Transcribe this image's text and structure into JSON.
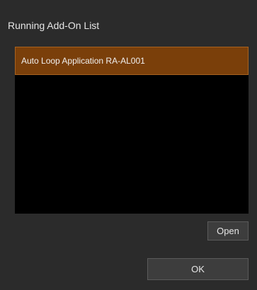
{
  "dialog": {
    "title": "Running Add-On List"
  },
  "list": {
    "items": [
      {
        "label": "Auto Loop Application RA-AL001",
        "selected": true
      }
    ]
  },
  "buttons": {
    "open_label": "Open",
    "ok_label": "OK"
  },
  "colors": {
    "background": "#2b2b2b",
    "list_background": "#000000",
    "selected_row": "#7a3f0a",
    "selected_border": "#a8621f",
    "button_background": "#3d3d3d",
    "text": "#e6e6e6"
  }
}
